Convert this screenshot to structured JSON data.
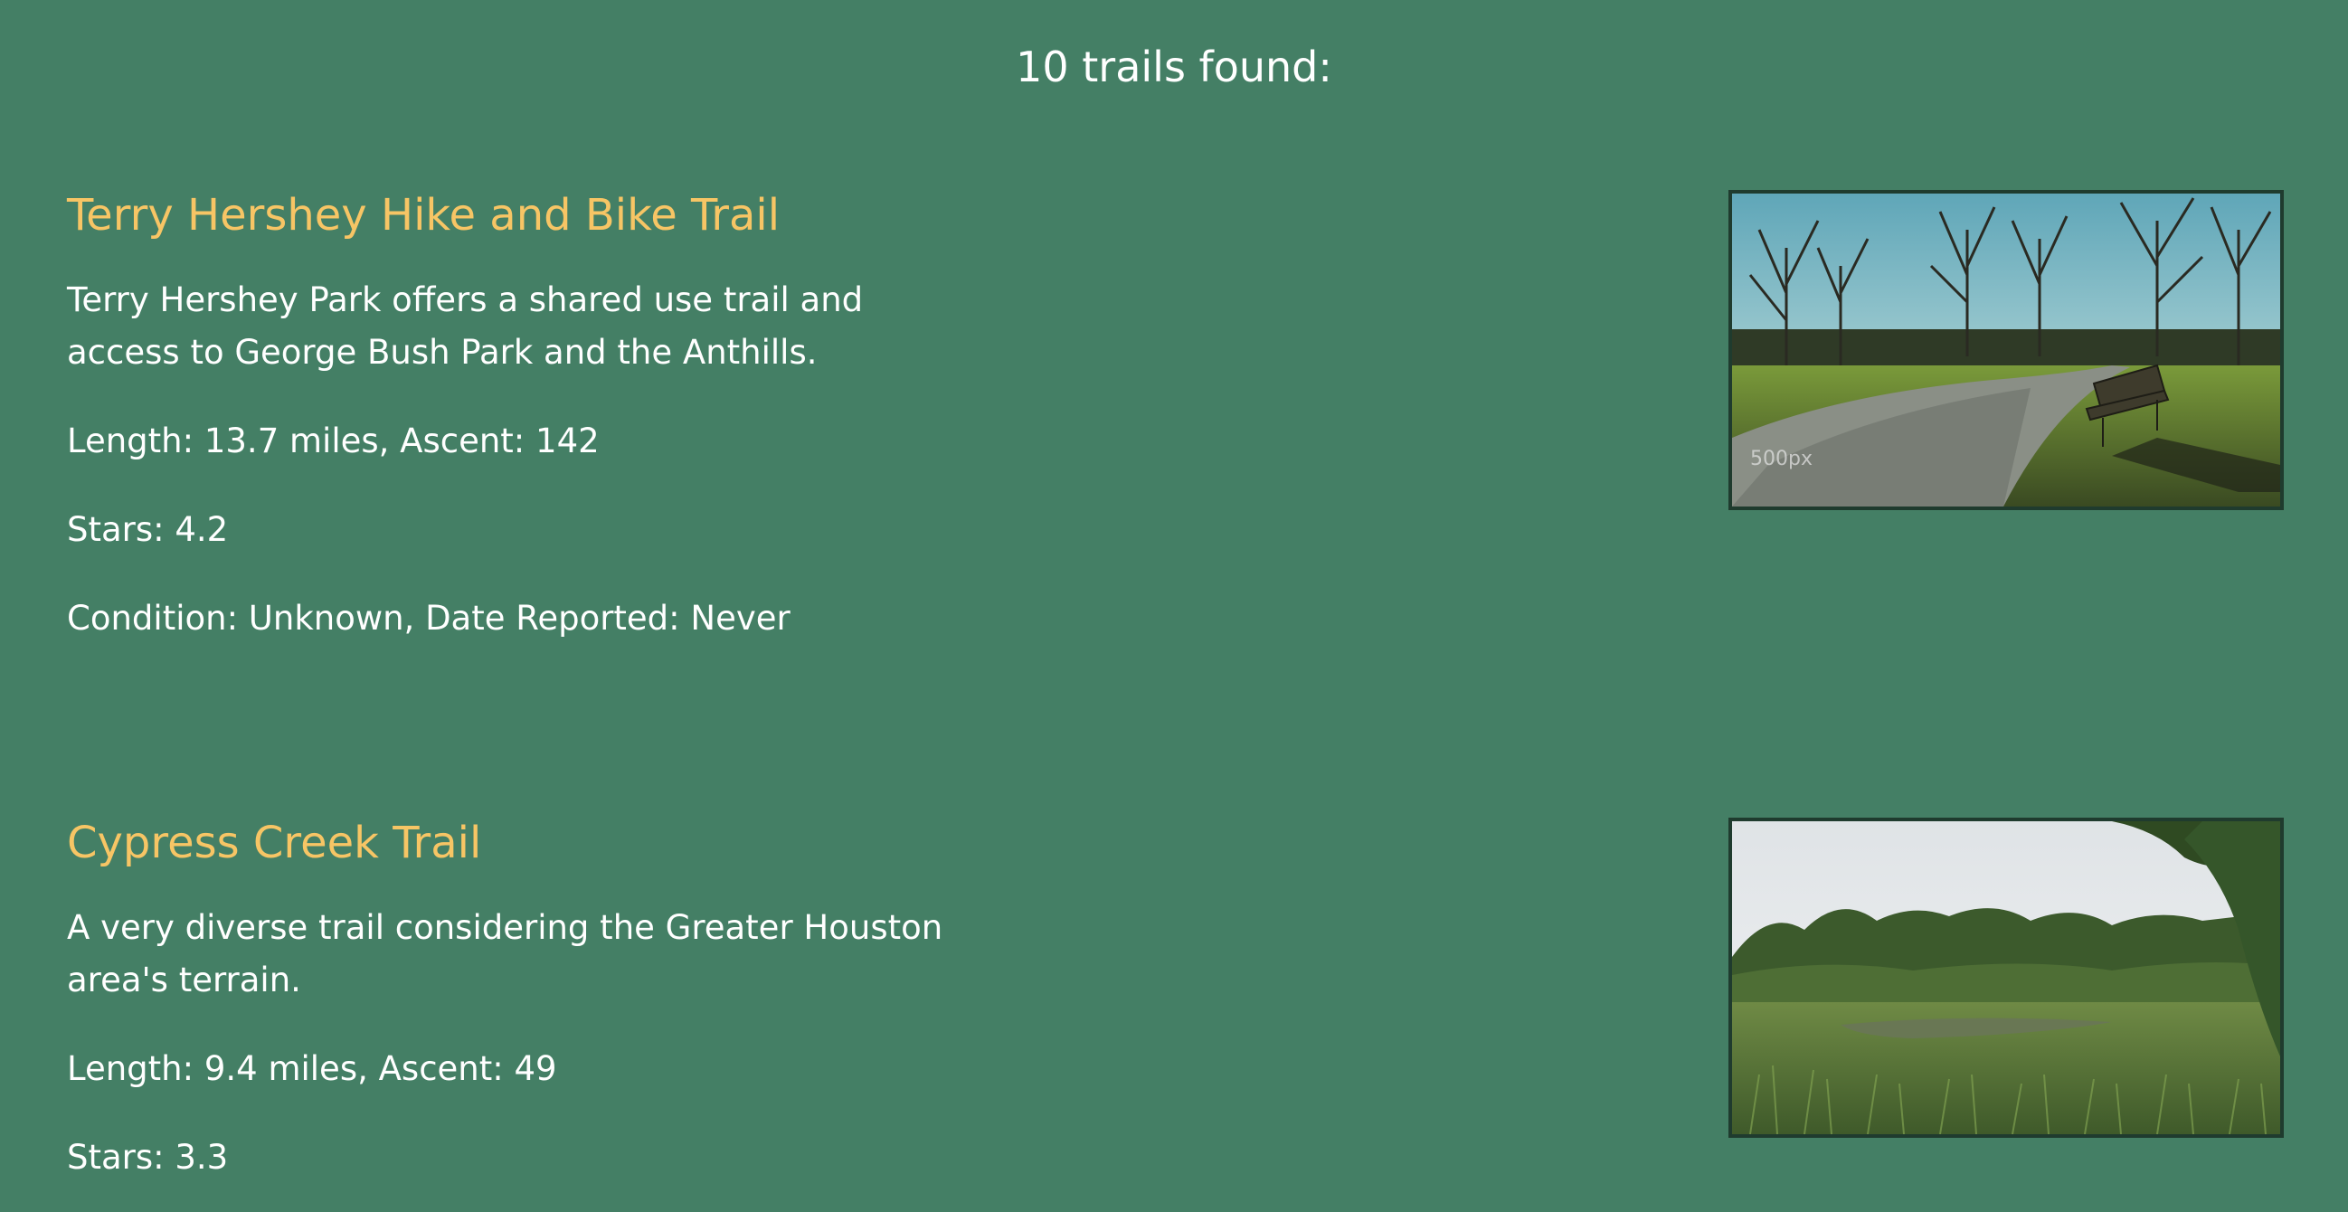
{
  "results": {
    "heading": "10 trails found:"
  },
  "trails": [
    {
      "name": "Terry Hershey Hike and Bike Trail",
      "summary": "Terry Hershey Park offers a shared use trail and access to George Bush Park and the Anthills.",
      "length_ascent": "Length: 13.7 miles, Ascent: 142",
      "stars": "Stars: 4.2",
      "condition": "Condition: Unknown, Date Reported: Never",
      "photo": {
        "watermark": "500px"
      }
    },
    {
      "name": "Cypress Creek Trail",
      "summary": "A very diverse trail considering the Greater Houston area's terrain.",
      "length_ascent": "Length: 9.4 miles, Ascent: 49",
      "stars": "Stars: 3.3"
    }
  ],
  "colors": {
    "background": "#447f65",
    "trail_name": "#f7c565",
    "text": "#ffffff",
    "photo_border": "#1f3b2e"
  }
}
